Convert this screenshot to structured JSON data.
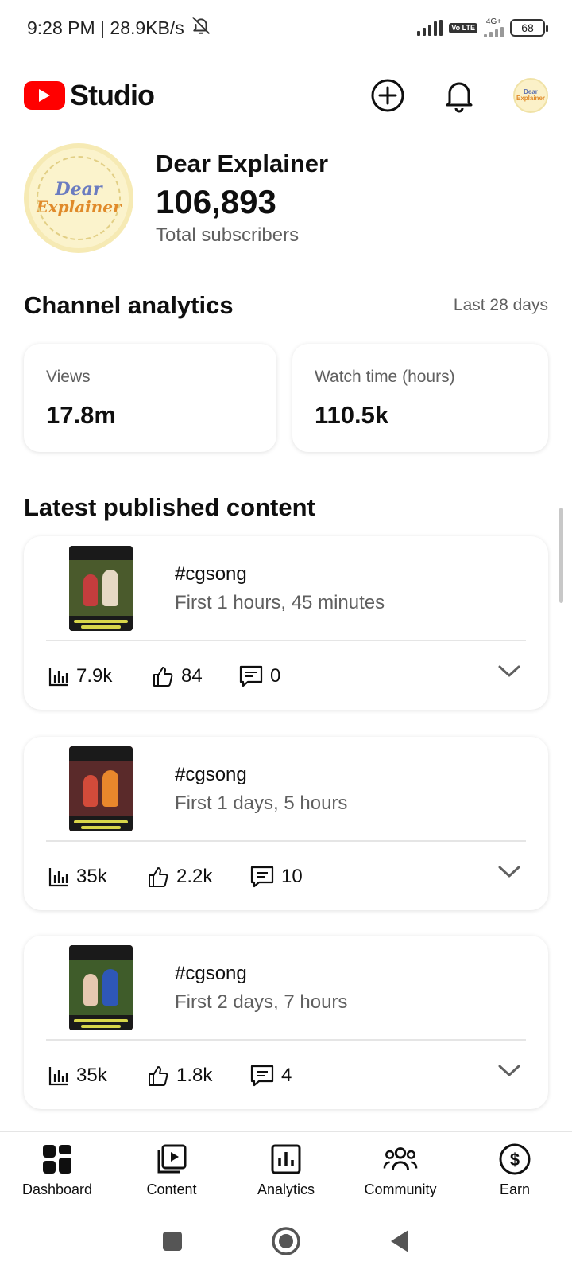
{
  "status_bar": {
    "time_speed": "9:28 PM | 28.9KB/s",
    "volte": "Vo LTE",
    "network": "4G+",
    "battery": "68"
  },
  "header": {
    "brand": "Studio",
    "avatar_text_1": "Dear",
    "avatar_text_2": "Explainer"
  },
  "channel": {
    "avatar_line1": "Dear",
    "avatar_line2": "Explainer",
    "name": "Dear Explainer",
    "subscribers": "106,893",
    "subscribers_label": "Total subscribers"
  },
  "analytics": {
    "title": "Channel analytics",
    "range": "Last 28 days",
    "cards": [
      {
        "label": "Views",
        "value": "17.8m"
      },
      {
        "label": "Watch time (hours)",
        "value": "110.5k"
      }
    ]
  },
  "latest": {
    "title": "Latest published content",
    "items": [
      {
        "title": "#cgsong",
        "subtitle": "First 1 hours, 45 minutes",
        "views": "7.9k",
        "likes": "84",
        "comments": "0"
      },
      {
        "title": "#cgsong",
        "subtitle": "First 1 days, 5 hours",
        "views": "35k",
        "likes": "2.2k",
        "comments": "10"
      },
      {
        "title": "#cgsong",
        "subtitle": "First 2 days, 7 hours",
        "views": "35k",
        "likes": "1.8k",
        "comments": "4"
      }
    ]
  },
  "nav": {
    "items": [
      {
        "label": "Dashboard",
        "icon": "dashboard-icon"
      },
      {
        "label": "Content",
        "icon": "content-icon"
      },
      {
        "label": "Analytics",
        "icon": "analytics-icon"
      },
      {
        "label": "Community",
        "icon": "community-icon"
      },
      {
        "label": "Earn",
        "icon": "earn-icon"
      }
    ]
  },
  "colors": {
    "brand_red": "#ff0000",
    "text_primary": "#0f0f0f",
    "text_secondary": "#606060"
  }
}
